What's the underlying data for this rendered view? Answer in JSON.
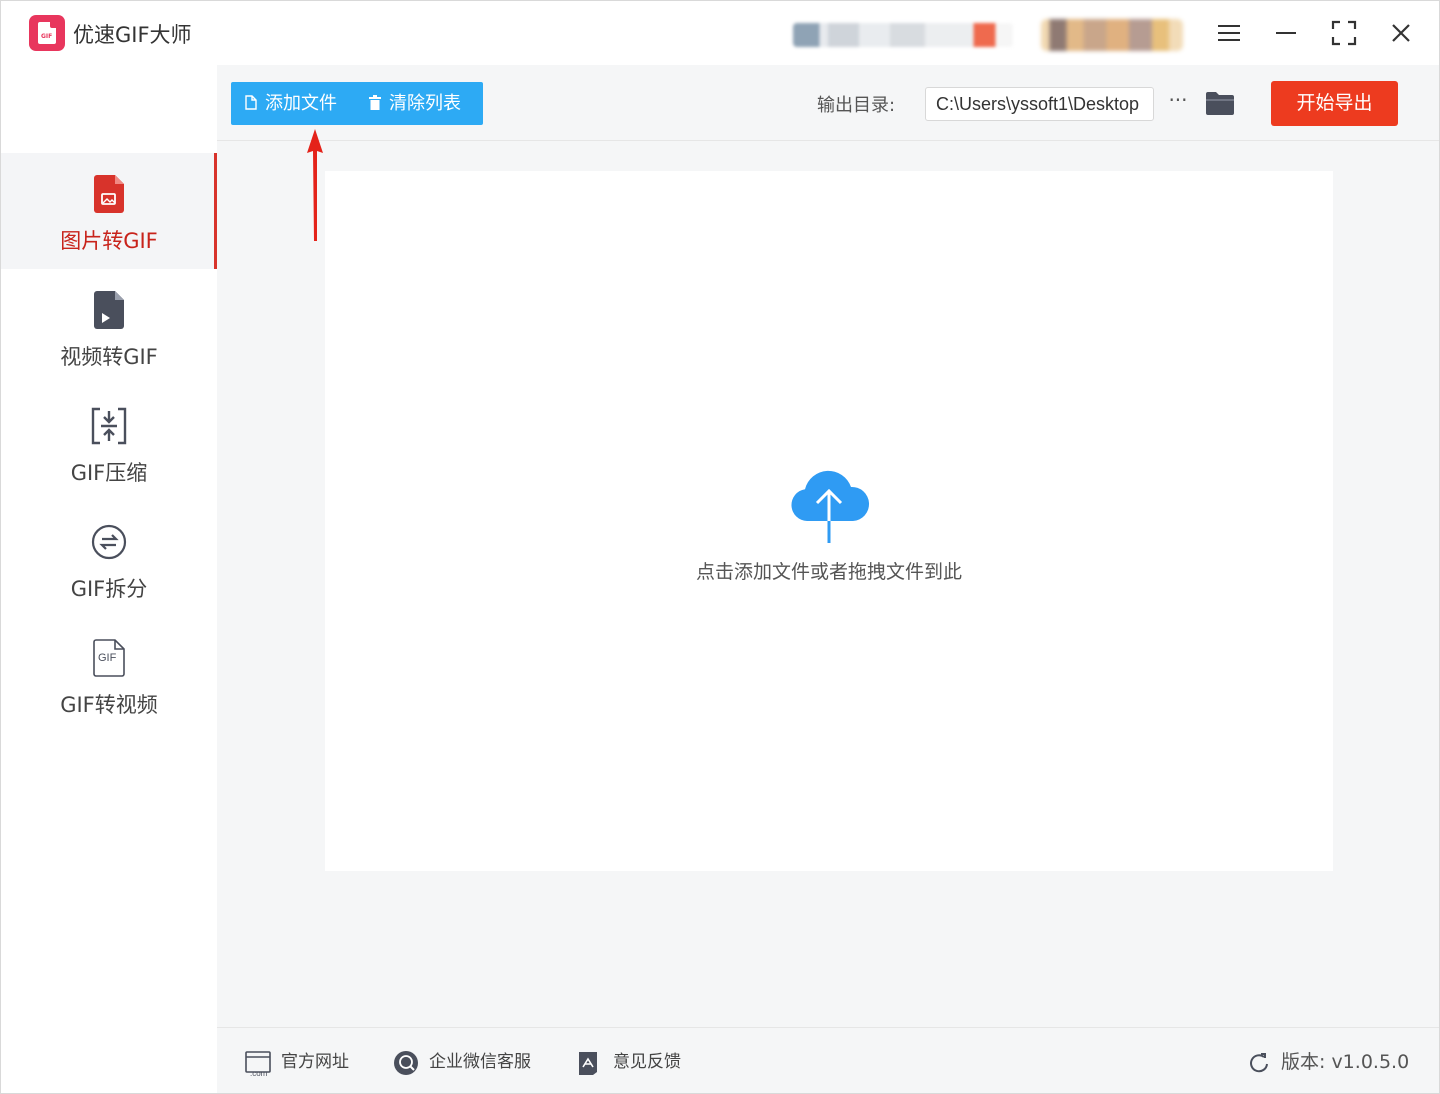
{
  "window": {
    "app_title": "优速GIF大师",
    "logo_text": "GIF"
  },
  "sidebar": {
    "items": [
      {
        "label": "图片转GIF",
        "icon": "image-file-icon",
        "active": true
      },
      {
        "label": "视频转GIF",
        "icon": "video-file-icon",
        "active": false
      },
      {
        "label": "GIF压缩",
        "icon": "compress-icon",
        "active": false
      },
      {
        "label": "GIF拆分",
        "icon": "split-icon",
        "active": false
      },
      {
        "label": "GIF转视频",
        "icon": "gif-file-icon",
        "active": false
      }
    ],
    "gif_icon_text": "GIF"
  },
  "toolbar": {
    "add_label": "添加文件",
    "clear_label": "清除列表",
    "output_label": "输出目录:",
    "output_path": "C:\\Users\\yssoft1\\Desktop",
    "more_label": "···",
    "export_label": "开始导出"
  },
  "dropzone": {
    "hint": "点击添加文件或者拖拽文件到此"
  },
  "footer": {
    "website_label": "官方网址",
    "website_icon_text": ".com",
    "wechat_label": "企业微信客服",
    "feedback_label": "意见反馈",
    "version_label": "版本: v1.0.5.0"
  },
  "colors": {
    "accent_blue": "#2daaf4",
    "export_red": "#ed3b1f",
    "active_red": "#c8231b",
    "logo_pink": "#e8365d"
  }
}
